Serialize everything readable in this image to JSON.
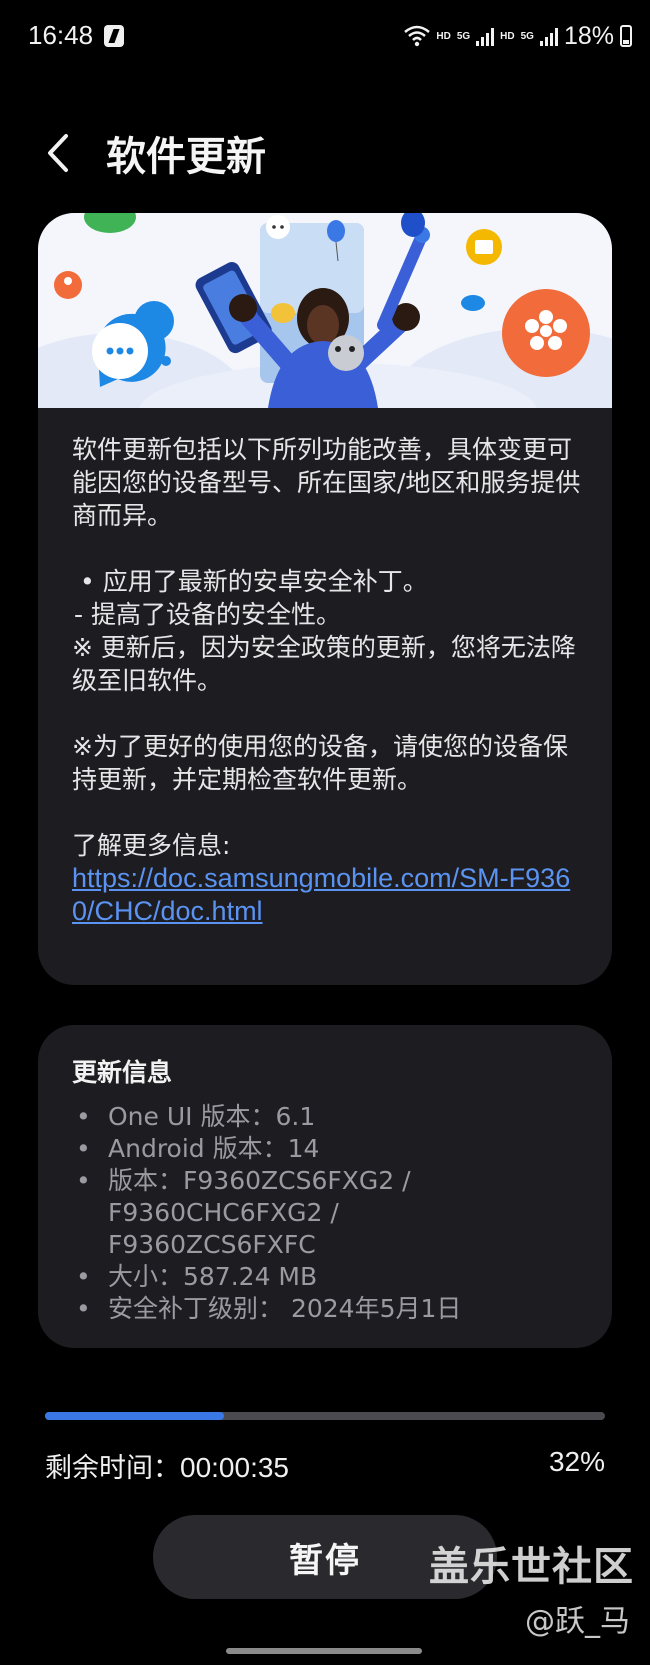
{
  "status_bar": {
    "time": "16:48",
    "network_hd_1": "HD",
    "network_5g_1": "5G",
    "network_hd_2": "HD",
    "network_5g_2": "5G",
    "battery": "18%"
  },
  "header": {
    "title": "软件更新",
    "back_icon": "chevron-left-icon"
  },
  "release_notes": {
    "intro": "软件更新包括以下所列功能改善，具体变更可能因您的设备型号、所在国家/地区和服务提供商而异。",
    "bullet": "• 应用了最新的安卓安全补丁。",
    "dash": "- 提高了设备的安全性。",
    "note": "※ 更新后，因为安全政策的更新，您将无法降级至旧软件。",
    "advice": "※为了更好的使用您的设备，请使您的设备保持更新，并定期检查软件更新。",
    "more_info_label": "了解更多信息:",
    "link": "https://doc.samsungmobile.com/SM-F9360/CHC/doc.html"
  },
  "update_info": {
    "title": "更新信息",
    "one_ui": "One UI 版本：6.1",
    "android": "Android 版本：14",
    "version_line1": "版本：F9360ZCS6FXG2 /",
    "version_line2": "F9360CHC6FXG2 /",
    "version_line3": "F9360ZCS6FXFC",
    "size": "大小：587.24 MB",
    "patch": "安全补丁级别： 2024年5月1日"
  },
  "progress": {
    "fraction": 0.32,
    "remaining_label": "剩余时间：",
    "remaining_time": "00:00:35",
    "percent": "32%"
  },
  "actions": {
    "pause_label": "暂停"
  },
  "watermark": {
    "title": "盖乐世社区",
    "author": "@跃_马"
  },
  "colors": {
    "background": "#000000",
    "card": "#1d1d21",
    "accent": "#3a78e6",
    "link": "#5b93f2"
  }
}
